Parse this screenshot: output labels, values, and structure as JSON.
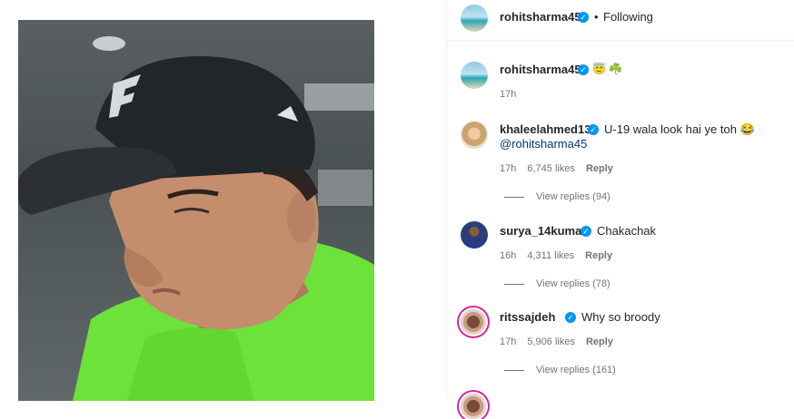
{
  "post": {
    "author": "rohitsharma45",
    "follow_state": "Following",
    "separator": "•",
    "caption_emoji_1": "😇",
    "caption_emoji_2": "☘️",
    "caption_time": "17h"
  },
  "comments": [
    {
      "username": "khaleelahmed13",
      "text": "U-19 wala look hai ye toh 😂",
      "mention": "@rohitsharma45",
      "time": "17h",
      "likes": "6,745 likes",
      "reply": "Reply",
      "view_replies": "View replies (94)"
    },
    {
      "username": "surya_14kumar",
      "text": "Chakachak",
      "time": "16h",
      "likes": "4,311 likes",
      "reply": "Reply",
      "view_replies": "View replies (78)"
    },
    {
      "username": "ritssajdeh",
      "text": "Why so broody",
      "time": "17h",
      "likes": "5,906 likes",
      "reply": "Reply",
      "view_replies": "View replies (161)"
    }
  ],
  "colors": {
    "verified_blue": "#0095f6",
    "mention_blue": "#00376b",
    "meta_gray": "#737373"
  }
}
